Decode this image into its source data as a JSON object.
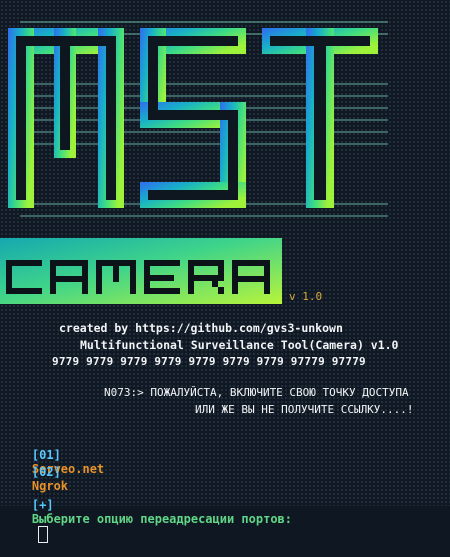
{
  "banner": {
    "title_art": "MST",
    "subtitle_art": "CAMERA",
    "version": "v 1.0"
  },
  "info": {
    "created_by": "created by https://github.com/gvs3-unkown",
    "tool_name": "Multifunctional Surveillance Tool(Camera) v1.0",
    "ports_line": "9779 9779 9779 9779 9779 9779 9779 97779 97779"
  },
  "notice": {
    "line1": "N073:> ПОЖАЛУЙСТА, ВКЛЮЧИТЕ СВОЮ ТОЧКУ ДОСТУПА",
    "line2": "ИЛИ ЖЕ ВЫ НЕ ПОЛУЧИТЕ ССЫЛКУ....!"
  },
  "menu": {
    "items": [
      {
        "number": "[01]",
        "label": "Serveo.net"
      },
      {
        "number": "[02]",
        "label": "Ngrok"
      }
    ]
  },
  "prompt": {
    "marker": "[+]",
    "text": "Выберите опцию переадресации портов:"
  },
  "colors": {
    "background": "#101823",
    "accent_blue": "#58c8ff",
    "accent_orange": "#e8922a",
    "accent_green": "#61d686",
    "version_gold": "#d6a83a"
  }
}
